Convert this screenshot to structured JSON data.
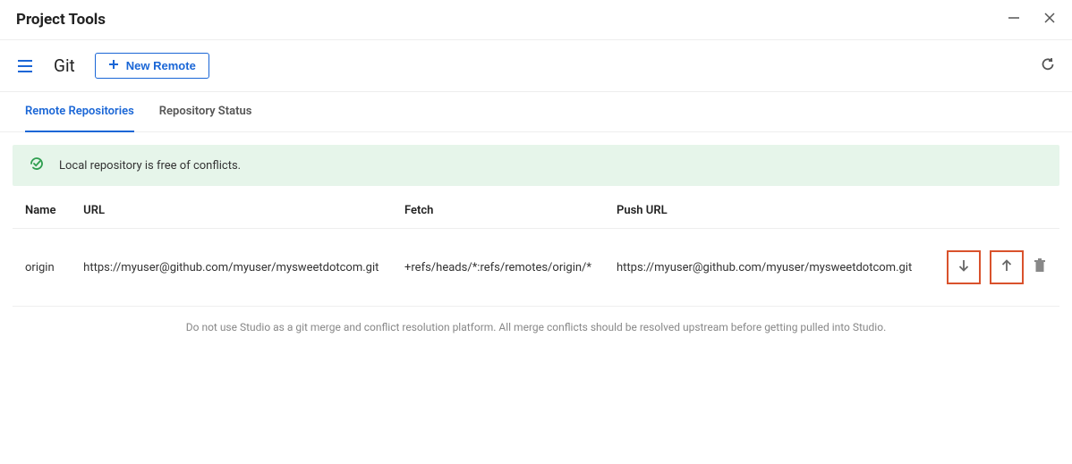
{
  "window": {
    "title": "Project Tools"
  },
  "toolbar": {
    "title": "Git",
    "new_remote_label": "New Remote"
  },
  "tabs": [
    {
      "label": "Remote Repositories",
      "active": true
    },
    {
      "label": "Repository Status",
      "active": false
    }
  ],
  "alert": {
    "text": "Local repository is free of conflicts."
  },
  "table": {
    "columns": [
      "Name",
      "URL",
      "Fetch",
      "Push URL"
    ],
    "rows": [
      {
        "name": "origin",
        "url": "https://myuser@github.com/myuser/mysweetdotcom.git",
        "fetch": "+refs/heads/*:refs/remotes/origin/*",
        "push_url": "https://myuser@github.com/myuser/mysweetdotcom.git"
      }
    ]
  },
  "footnote": "Do not use Studio as a git merge and conflict resolution platform. All merge conflicts should be resolved upstream before getting pulled into Studio."
}
